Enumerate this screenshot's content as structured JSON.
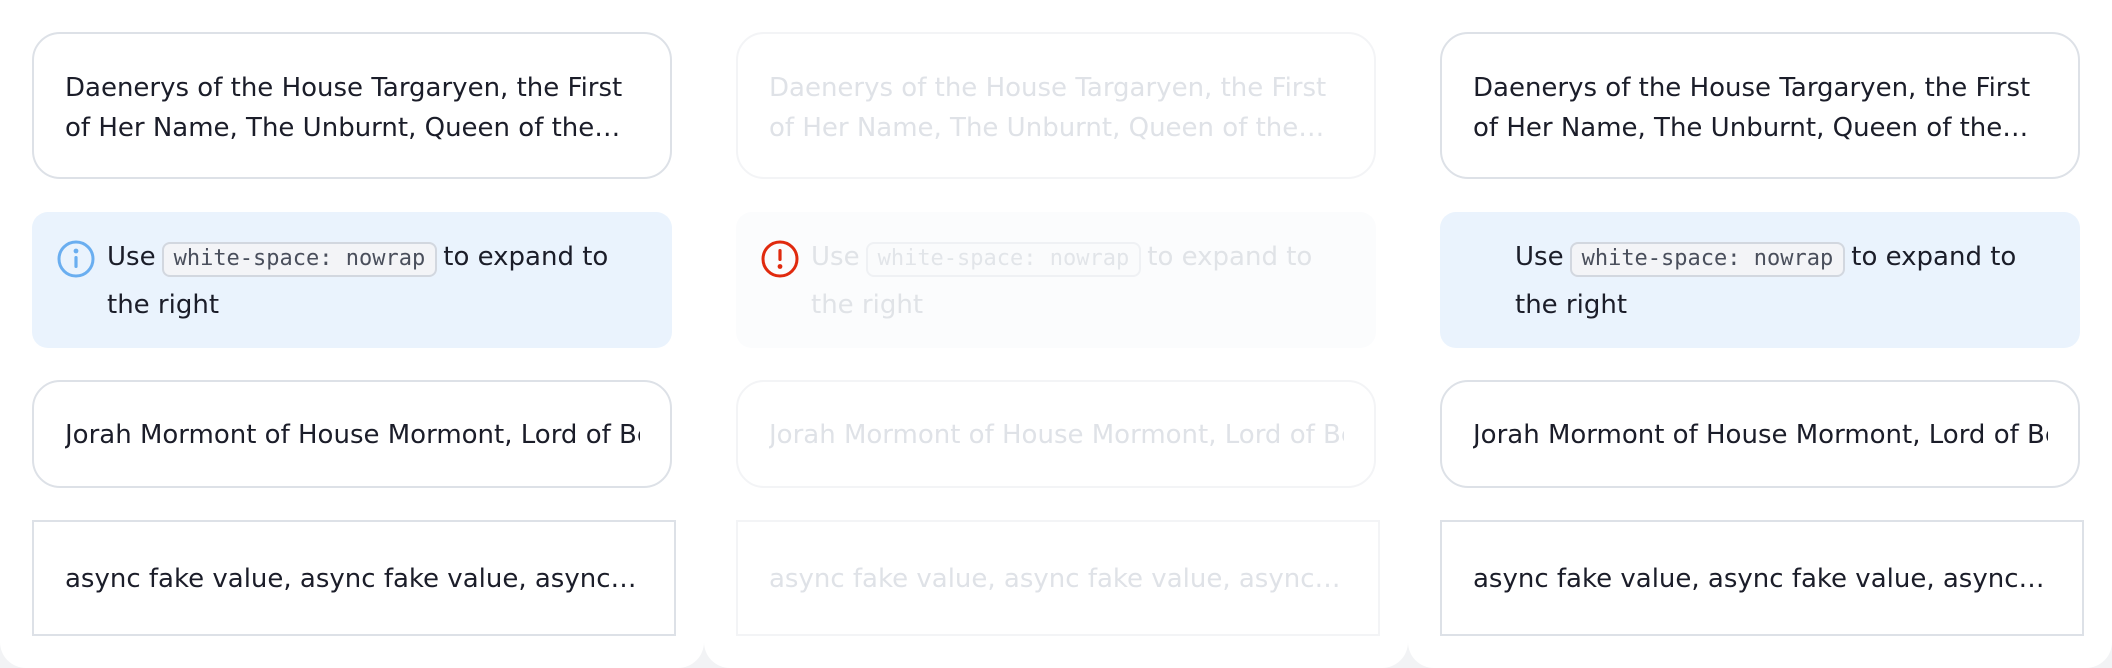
{
  "colors": {
    "info_blue": "#6aaef0",
    "warning_red": "#e02a0e",
    "hint_bg": "#eaf3fd",
    "border": "#dde1e7"
  },
  "columns": [
    {
      "state": "default",
      "card_title": "Daenerys of the House Targaryen, the First of Her Name, The Unburnt, Queen of the Andals, the Rhoynar and the First Men, Queen of Meereen, Khaleesi of the Great Grass Sea, Protector of the Realm, Lady Regnant of the Seven Kingdoms, Breaker of Chains and Mother of Dragons",
      "hint": {
        "icon": "info-circle-icon",
        "prefix": "Use",
        "code": "white-space: nowrap",
        "suffix": "to expand to the right"
      },
      "card_nowrap": "Jorah Mormont of House Mormont, Lord of Bear Island, Knight of the Kingsguard",
      "card_async": "async fake value, async fake value, async fake value, async fake value"
    },
    {
      "state": "disabled",
      "card_title": "Daenerys of the House Targaryen, the First of Her Name, The Unburnt, Queen of the Andals, the Rhoynar and the First Men, Queen of Meereen, Khaleesi of the Great Grass Sea, Protector of the Realm, Lady Regnant of the Seven Kingdoms, Breaker of Chains and Mother of Dragons",
      "hint": {
        "icon": "info-circle-icon",
        "prefix": "Use",
        "code": "white-space: nowrap",
        "suffix": "to expand to the right"
      },
      "card_nowrap": "Jorah Mormont of House Mormont, Lord of Bear Island, Knight of the Kingsguard",
      "card_async": "async fake value, async fake value, async fake value, async fake value"
    },
    {
      "state": "no-icon",
      "card_title": "Daenerys of the House Targaryen, the First of Her Name, The Unburnt, Queen of the Andals, the Rhoynar and the First Men, Queen of Meereen, Khaleesi of the Great Grass Sea, Protector of the Realm, Lady Regnant of the Seven Kingdoms, Breaker of Chains and Mother of Dragons",
      "hint": {
        "icon": "",
        "prefix": "Use",
        "code": "white-space: nowrap",
        "suffix": "to expand to the right"
      },
      "card_nowrap": "Jorah Mormont of House Mormont, Lord of Bear Island, Knight of the Kingsguard",
      "card_async": "async fake value, async fake value, async fake value, async fake value"
    }
  ]
}
